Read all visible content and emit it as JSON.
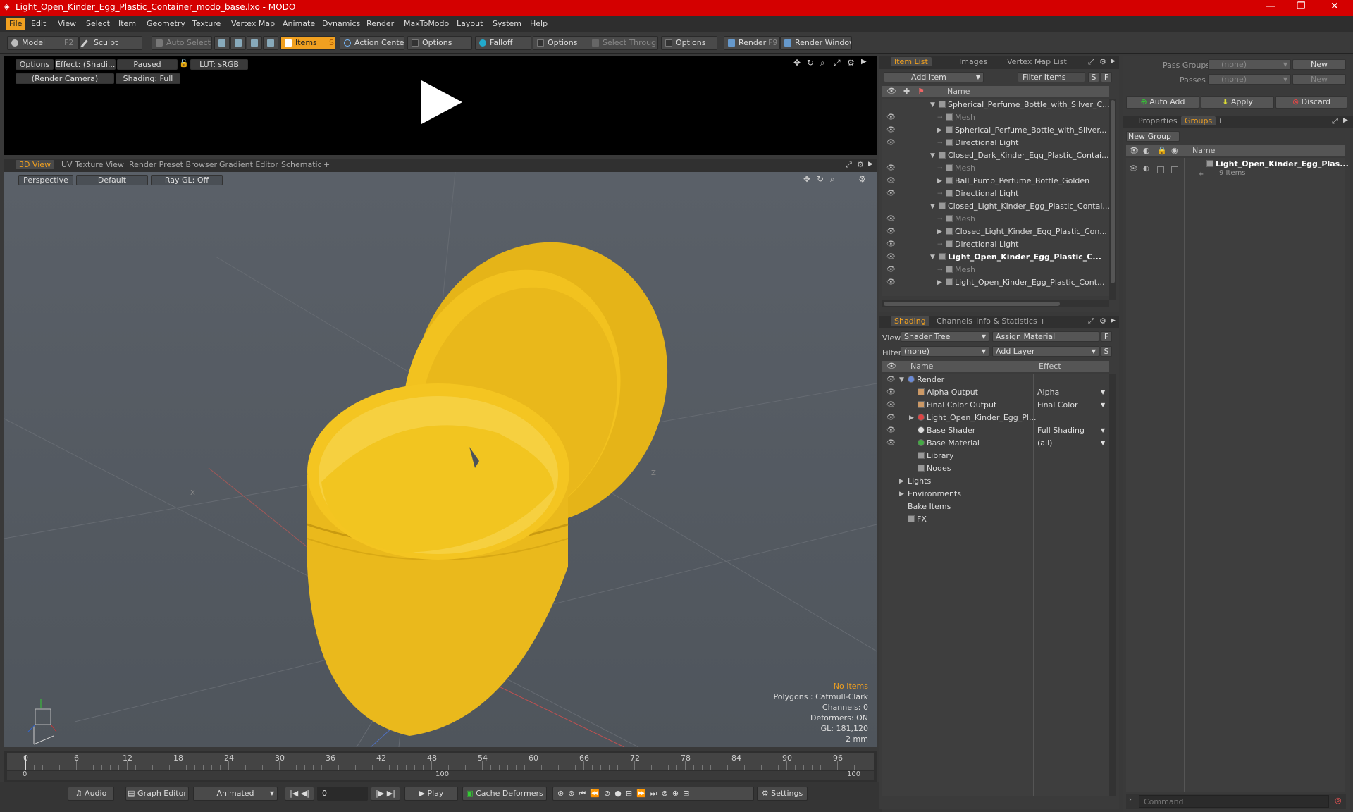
{
  "window": {
    "title": "Light_Open_Kinder_Egg_Plastic_Container_modo_base.lxo - MODO",
    "minimize": "—",
    "maximize": "❐",
    "close": "✕"
  },
  "menu": [
    "File",
    "Edit",
    "View",
    "Select",
    "Item",
    "Geometry",
    "Texture",
    "Vertex Map",
    "Animate",
    "Dynamics",
    "Render",
    "MaxToModo",
    "Layout",
    "System",
    "Help"
  ],
  "toolbar": {
    "model": "Model",
    "model_key": "F2",
    "sculpt": "Sculpt",
    "auto_select": "Auto Select",
    "items": "Items",
    "items_key": "S",
    "action_center": "Action Center",
    "options1": "Options",
    "falloff": "Falloff",
    "options2": "Options",
    "select_through": "Select Through",
    "options3": "Options",
    "render": "Render",
    "render_key": "F9",
    "render_window": "Render Window"
  },
  "preview": {
    "options": "Options",
    "effect": "Effect: (Shadi...",
    "paused": "Paused",
    "lut": "LUT: sRGB",
    "camera": "(Render Camera)",
    "shading": "Shading: Full"
  },
  "viewport": {
    "tabs": [
      "3D View",
      "UV Texture View",
      "Render Preset Browser",
      "Gradient Editor",
      "Schematic",
      "+"
    ],
    "perspective": "Perspective",
    "default": "Default",
    "raygl": "Ray GL: Off",
    "info": {
      "no_items": "No Items",
      "polygons": "Polygons : Catmull-Clark",
      "channels": "Channels: 0",
      "deformers": "Deformers: ON",
      "gl": "GL: 181,120",
      "unit": "2 mm"
    },
    "axis_x": "X",
    "axis_z": "Z"
  },
  "timeline": {
    "top_labels": [
      "0",
      "6",
      "12",
      "18",
      "24",
      "30",
      "36",
      "42",
      "48",
      "54",
      "60",
      "66",
      "72",
      "78",
      "84",
      "90",
      "96"
    ],
    "bottom_labels": [
      "0",
      "100",
      "100"
    ]
  },
  "bottombar": {
    "audio": "Audio",
    "graph_editor": "Graph Editor",
    "animated": "Animated",
    "frame": "0",
    "play": "Play",
    "cache": "Cache Deformers",
    "settings": "Settings"
  },
  "itemlist": {
    "tabs": [
      "Item List",
      "Images",
      "Vertex Map List",
      "+"
    ],
    "add_item": "Add Item",
    "filter": "Filter Items",
    "s": "S",
    "f": "F",
    "col_name": "Name",
    "rows": [
      {
        "label": "Spherical_Perfume_Bottle_with_Silver_C...",
        "indent": 0,
        "tri": "▼",
        "bold": false,
        "dim": false
      },
      {
        "label": "Mesh",
        "indent": 1,
        "tri": "",
        "bold": false,
        "dim": true
      },
      {
        "label": "Spherical_Perfume_Bottle_with_Silver...",
        "indent": 1,
        "tri": "▶",
        "bold": false,
        "dim": false
      },
      {
        "label": "Directional Light",
        "indent": 1,
        "tri": "",
        "bold": false,
        "dim": false
      },
      {
        "label": "Closed_Dark_Kinder_Egg_Plastic_Contai...",
        "indent": 0,
        "tri": "▼",
        "bold": false,
        "dim": false
      },
      {
        "label": "Mesh",
        "indent": 1,
        "tri": "",
        "bold": false,
        "dim": true
      },
      {
        "label": "Ball_Pump_Perfume_Bottle_Golden",
        "indent": 1,
        "tri": "▶",
        "bold": false,
        "dim": false
      },
      {
        "label": "Directional Light",
        "indent": 1,
        "tri": "",
        "bold": false,
        "dim": false
      },
      {
        "label": "Closed_Light_Kinder_Egg_Plastic_Contai...",
        "indent": 0,
        "tri": "▼",
        "bold": false,
        "dim": false
      },
      {
        "label": "Mesh",
        "indent": 1,
        "tri": "",
        "bold": false,
        "dim": true
      },
      {
        "label": "Closed_Light_Kinder_Egg_Plastic_Con...",
        "indent": 1,
        "tri": "▶",
        "bold": false,
        "dim": false
      },
      {
        "label": "Directional Light",
        "indent": 1,
        "tri": "",
        "bold": false,
        "dim": false
      },
      {
        "label": "Light_Open_Kinder_Egg_Plastic_C...",
        "indent": 0,
        "tri": "▼",
        "bold": true,
        "dim": false
      },
      {
        "label": "Mesh",
        "indent": 1,
        "tri": "",
        "bold": false,
        "dim": true
      },
      {
        "label": "Light_Open_Kinder_Egg_Plastic_Cont...",
        "indent": 1,
        "tri": "▶",
        "bold": false,
        "dim": false
      }
    ]
  },
  "shading": {
    "tabs": [
      "Shading",
      "Channels",
      "Info & Statistics",
      "+"
    ],
    "view_label": "View",
    "view_value": "Shader Tree",
    "assign": "Assign Material",
    "filter_label": "Filter",
    "filter_value": "(none)",
    "add_layer": "Add Layer",
    "f": "F",
    "s": "S",
    "col_name": "Name",
    "col_effect": "Effect",
    "rows": [
      {
        "label": "Render",
        "effect": "",
        "indent": 0,
        "tri": "▼",
        "eye": true
      },
      {
        "label": "Alpha Output",
        "effect": "Alpha",
        "indent": 1,
        "tri": "",
        "eye": true
      },
      {
        "label": "Final Color Output",
        "effect": "Final Color",
        "indent": 1,
        "tri": "",
        "eye": true
      },
      {
        "label": "Light_Open_Kinder_Egg_Pl...",
        "effect": "",
        "indent": 1,
        "tri": "▶",
        "eye": true
      },
      {
        "label": "Base Shader",
        "effect": "Full Shading",
        "indent": 1,
        "tri": "",
        "eye": true
      },
      {
        "label": "Base Material",
        "effect": "(all)",
        "indent": 1,
        "tri": "",
        "eye": true
      },
      {
        "label": "Library",
        "effect": "",
        "indent": 1,
        "tri": "",
        "eye": false
      },
      {
        "label": "Nodes",
        "effect": "",
        "indent": 1,
        "tri": "",
        "eye": false
      },
      {
        "label": "Lights",
        "effect": "",
        "indent": 0,
        "tri": "▶",
        "eye": false
      },
      {
        "label": "Environments",
        "effect": "",
        "indent": 0,
        "tri": "▶",
        "eye": false
      },
      {
        "label": "Bake Items",
        "effect": "",
        "indent": 0,
        "tri": "",
        "eye": false
      },
      {
        "label": "FX",
        "effect": "",
        "indent": 0,
        "tri": "",
        "eye": false
      }
    ]
  },
  "groups": {
    "pass_groups": "Pass Groups",
    "pass_value": "(none)",
    "new": "New",
    "passes": "Passes",
    "passes_value": "(none)",
    "new2": "New",
    "auto_add": "Auto Add",
    "apply": "Apply",
    "discard": "Discard",
    "tabs": [
      "Properties",
      "Groups",
      "+"
    ],
    "new_group": "New Group",
    "col_name": "Name",
    "item_name": "Light_Open_Kinder_Egg_Plas...",
    "item_count": "9 Items"
  },
  "command": {
    "placeholder": "Command"
  },
  "colors": {
    "accent": "#f0a020",
    "title_bg": "#d40000",
    "egg": "#f2c21f"
  }
}
